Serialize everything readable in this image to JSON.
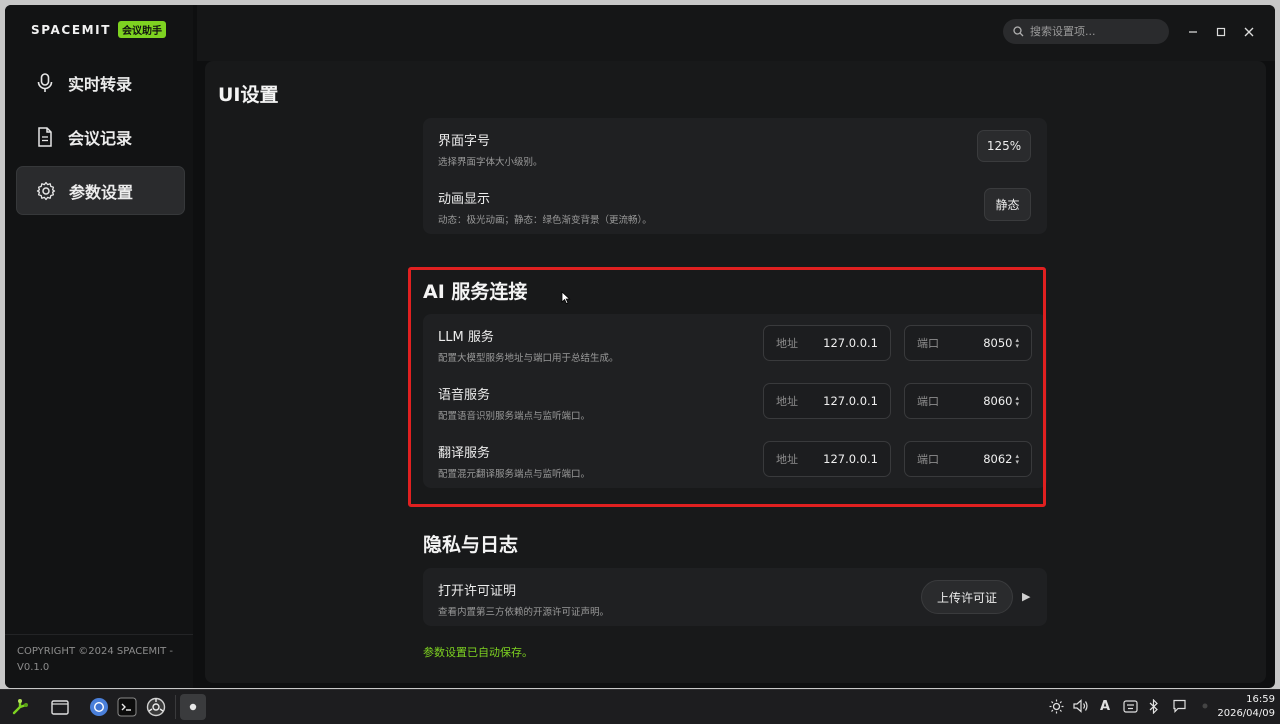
{
  "brand": {
    "logo": "SPACEMIT",
    "badge": "会议助手"
  },
  "nav": [
    {
      "label": "实时转录",
      "icon": "microphone-icon"
    },
    {
      "label": "会议记录",
      "icon": "document-icon"
    },
    {
      "label": "参数设置",
      "icon": "gear-icon"
    }
  ],
  "copyright": "COPYRIGHT ©2024 SPACEMIT - V0.1.0",
  "search": {
    "placeholder": "搜索设置项..."
  },
  "ui_settings": {
    "title": "UI设置",
    "font": {
      "title": "界面字号",
      "desc": "选择界面字体大小级别。",
      "value": "125%"
    },
    "animation": {
      "title": "动画显示",
      "desc": "动态：极光动画；静态：绿色渐变背景（更流畅）。",
      "value": "静态"
    }
  },
  "ai_services": {
    "title": "AI 服务连接",
    "addr_label": "地址",
    "port_label": "端口",
    "items": [
      {
        "title": "LLM 服务",
        "desc": "配置大模型服务地址与端口用于总结生成。",
        "addr": "127.0.0.1",
        "port": "8050"
      },
      {
        "title": "语音服务",
        "desc": "配置语音识别服务端点与监听端口。",
        "addr": "127.0.0.1",
        "port": "8060"
      },
      {
        "title": "翻译服务",
        "desc": "配置混元翻译服务端点与监听端口。",
        "addr": "127.0.0.1",
        "port": "8062"
      }
    ]
  },
  "privacy": {
    "title": "隐私与日志",
    "license": {
      "title": "打开许可证明",
      "desc": "查看内置第三方依赖的开源许可证声明。",
      "button": "上传许可证"
    }
  },
  "autosave": "参数设置已自动保存。",
  "taskbar": {
    "time": "16:59",
    "date": "2026/04/09",
    "input_method": "A"
  },
  "colors": {
    "accent": "#7ed321",
    "highlight": "#e02020",
    "background": "#18191a"
  }
}
